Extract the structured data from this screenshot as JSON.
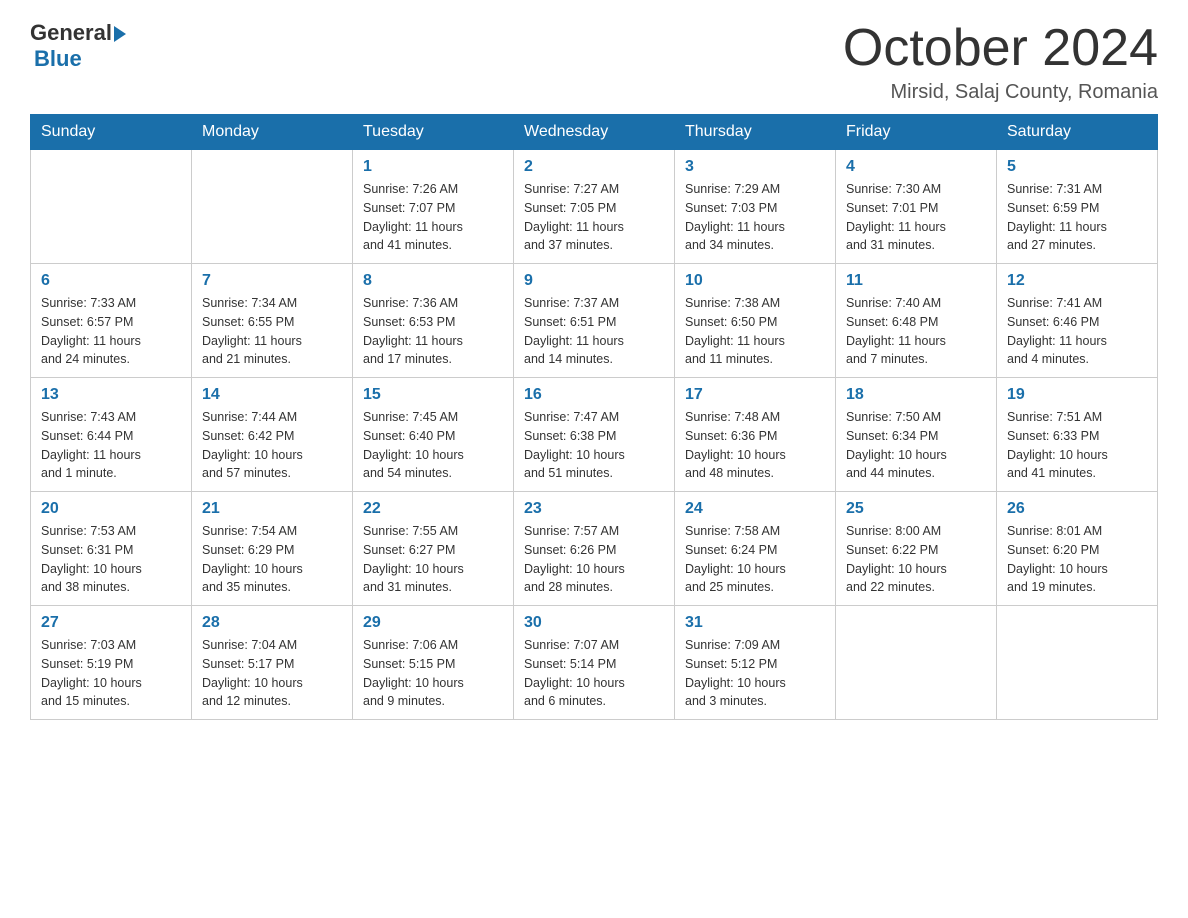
{
  "logo": {
    "text_general": "General",
    "text_blue": "Blue",
    "arrow_unicode": "▶"
  },
  "title": "October 2024",
  "subtitle": "Mirsid, Salaj County, Romania",
  "days_of_week": [
    "Sunday",
    "Monday",
    "Tuesday",
    "Wednesday",
    "Thursday",
    "Friday",
    "Saturday"
  ],
  "weeks": [
    [
      {
        "day": "",
        "info": ""
      },
      {
        "day": "",
        "info": ""
      },
      {
        "day": "1",
        "info": "Sunrise: 7:26 AM\nSunset: 7:07 PM\nDaylight: 11 hours\nand 41 minutes."
      },
      {
        "day": "2",
        "info": "Sunrise: 7:27 AM\nSunset: 7:05 PM\nDaylight: 11 hours\nand 37 minutes."
      },
      {
        "day": "3",
        "info": "Sunrise: 7:29 AM\nSunset: 7:03 PM\nDaylight: 11 hours\nand 34 minutes."
      },
      {
        "day": "4",
        "info": "Sunrise: 7:30 AM\nSunset: 7:01 PM\nDaylight: 11 hours\nand 31 minutes."
      },
      {
        "day": "5",
        "info": "Sunrise: 7:31 AM\nSunset: 6:59 PM\nDaylight: 11 hours\nand 27 minutes."
      }
    ],
    [
      {
        "day": "6",
        "info": "Sunrise: 7:33 AM\nSunset: 6:57 PM\nDaylight: 11 hours\nand 24 minutes."
      },
      {
        "day": "7",
        "info": "Sunrise: 7:34 AM\nSunset: 6:55 PM\nDaylight: 11 hours\nand 21 minutes."
      },
      {
        "day": "8",
        "info": "Sunrise: 7:36 AM\nSunset: 6:53 PM\nDaylight: 11 hours\nand 17 minutes."
      },
      {
        "day": "9",
        "info": "Sunrise: 7:37 AM\nSunset: 6:51 PM\nDaylight: 11 hours\nand 14 minutes."
      },
      {
        "day": "10",
        "info": "Sunrise: 7:38 AM\nSunset: 6:50 PM\nDaylight: 11 hours\nand 11 minutes."
      },
      {
        "day": "11",
        "info": "Sunrise: 7:40 AM\nSunset: 6:48 PM\nDaylight: 11 hours\nand 7 minutes."
      },
      {
        "day": "12",
        "info": "Sunrise: 7:41 AM\nSunset: 6:46 PM\nDaylight: 11 hours\nand 4 minutes."
      }
    ],
    [
      {
        "day": "13",
        "info": "Sunrise: 7:43 AM\nSunset: 6:44 PM\nDaylight: 11 hours\nand 1 minute."
      },
      {
        "day": "14",
        "info": "Sunrise: 7:44 AM\nSunset: 6:42 PM\nDaylight: 10 hours\nand 57 minutes."
      },
      {
        "day": "15",
        "info": "Sunrise: 7:45 AM\nSunset: 6:40 PM\nDaylight: 10 hours\nand 54 minutes."
      },
      {
        "day": "16",
        "info": "Sunrise: 7:47 AM\nSunset: 6:38 PM\nDaylight: 10 hours\nand 51 minutes."
      },
      {
        "day": "17",
        "info": "Sunrise: 7:48 AM\nSunset: 6:36 PM\nDaylight: 10 hours\nand 48 minutes."
      },
      {
        "day": "18",
        "info": "Sunrise: 7:50 AM\nSunset: 6:34 PM\nDaylight: 10 hours\nand 44 minutes."
      },
      {
        "day": "19",
        "info": "Sunrise: 7:51 AM\nSunset: 6:33 PM\nDaylight: 10 hours\nand 41 minutes."
      }
    ],
    [
      {
        "day": "20",
        "info": "Sunrise: 7:53 AM\nSunset: 6:31 PM\nDaylight: 10 hours\nand 38 minutes."
      },
      {
        "day": "21",
        "info": "Sunrise: 7:54 AM\nSunset: 6:29 PM\nDaylight: 10 hours\nand 35 minutes."
      },
      {
        "day": "22",
        "info": "Sunrise: 7:55 AM\nSunset: 6:27 PM\nDaylight: 10 hours\nand 31 minutes."
      },
      {
        "day": "23",
        "info": "Sunrise: 7:57 AM\nSunset: 6:26 PM\nDaylight: 10 hours\nand 28 minutes."
      },
      {
        "day": "24",
        "info": "Sunrise: 7:58 AM\nSunset: 6:24 PM\nDaylight: 10 hours\nand 25 minutes."
      },
      {
        "day": "25",
        "info": "Sunrise: 8:00 AM\nSunset: 6:22 PM\nDaylight: 10 hours\nand 22 minutes."
      },
      {
        "day": "26",
        "info": "Sunrise: 8:01 AM\nSunset: 6:20 PM\nDaylight: 10 hours\nand 19 minutes."
      }
    ],
    [
      {
        "day": "27",
        "info": "Sunrise: 7:03 AM\nSunset: 5:19 PM\nDaylight: 10 hours\nand 15 minutes."
      },
      {
        "day": "28",
        "info": "Sunrise: 7:04 AM\nSunset: 5:17 PM\nDaylight: 10 hours\nand 12 minutes."
      },
      {
        "day": "29",
        "info": "Sunrise: 7:06 AM\nSunset: 5:15 PM\nDaylight: 10 hours\nand 9 minutes."
      },
      {
        "day": "30",
        "info": "Sunrise: 7:07 AM\nSunset: 5:14 PM\nDaylight: 10 hours\nand 6 minutes."
      },
      {
        "day": "31",
        "info": "Sunrise: 7:09 AM\nSunset: 5:12 PM\nDaylight: 10 hours\nand 3 minutes."
      },
      {
        "day": "",
        "info": ""
      },
      {
        "day": "",
        "info": ""
      }
    ]
  ]
}
